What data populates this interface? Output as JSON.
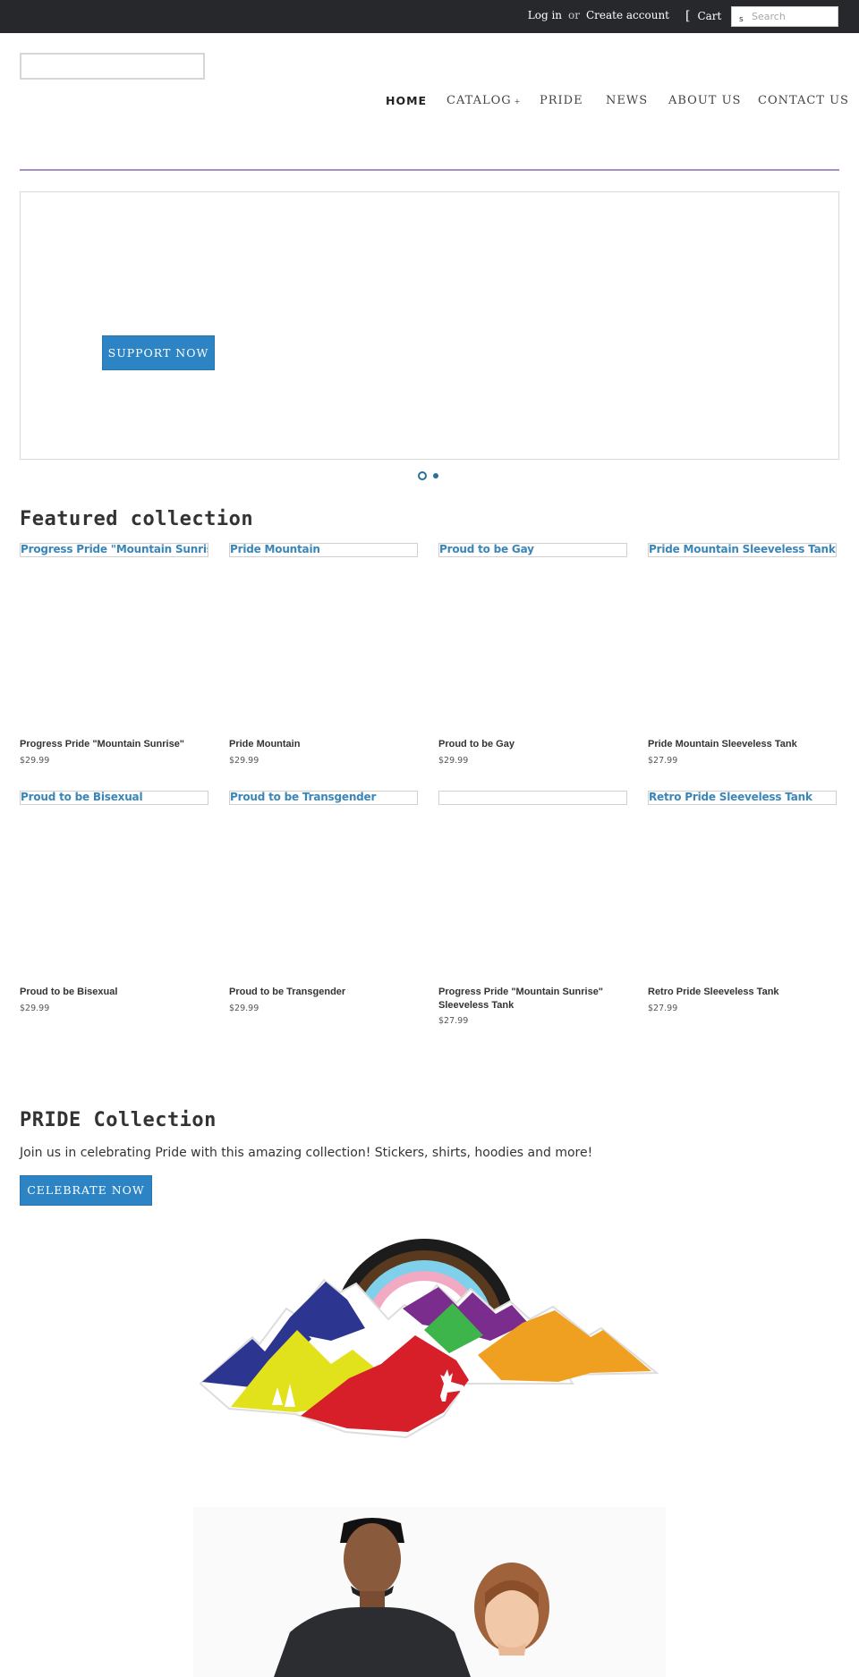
{
  "topbar": {
    "login": "Log in",
    "or": "or",
    "create_account": "Create account",
    "cart_bracket": "[",
    "cart": "Cart",
    "search_icon": "s",
    "search_placeholder": "Search"
  },
  "nav": {
    "items": [
      {
        "label": "HOME"
      },
      {
        "label": "CATALOG",
        "caret": "+"
      },
      {
        "label": "PRIDE"
      },
      {
        "label": "NEWS"
      },
      {
        "label": "ABOUT US"
      },
      {
        "label": "CONTACT US"
      }
    ]
  },
  "slideshow": {
    "button": "SUPPORT NOW"
  },
  "featured": {
    "title": "Featured collection",
    "products": [
      {
        "alt": "Progress Pride \"Mountain Sunrise\"",
        "title": "Progress Pride \"Mountain Sunrise\"",
        "price": "$29.99"
      },
      {
        "alt": "Pride Mountain",
        "title": "Pride Mountain",
        "price": "$29.99"
      },
      {
        "alt": "Proud to be Gay",
        "title": "Proud to be Gay",
        "price": "$29.99"
      },
      {
        "alt": "Pride Mountain Sleeveless Tank",
        "title": "Pride Mountain Sleeveless Tank",
        "price": "$27.99"
      },
      {
        "alt": "Proud to be Bisexual",
        "title": "Proud to be Bisexual",
        "price": "$29.99"
      },
      {
        "alt": "Proud to be Transgender",
        "title": "Proud to be Transgender",
        "price": "$29.99"
      },
      {
        "alt": "",
        "title": "Progress Pride \"Mountain Sunrise\" Sleeveless Tank",
        "price": "$27.99"
      },
      {
        "alt": "Retro Pride Sleeveless Tank",
        "title": "Retro Pride Sleeveless Tank",
        "price": "$27.99"
      }
    ]
  },
  "pride": {
    "title": "PRIDE Collection",
    "text": "Join us in celebrating Pride with this amazing collection! Stickers, shirts, hoodies and more!",
    "button": "CELEBRATE NOW"
  },
  "colors": {
    "topbar": "#26282c",
    "accent": "#2d84c4",
    "rule": "#a78fc3",
    "link": "#3a86b8"
  }
}
